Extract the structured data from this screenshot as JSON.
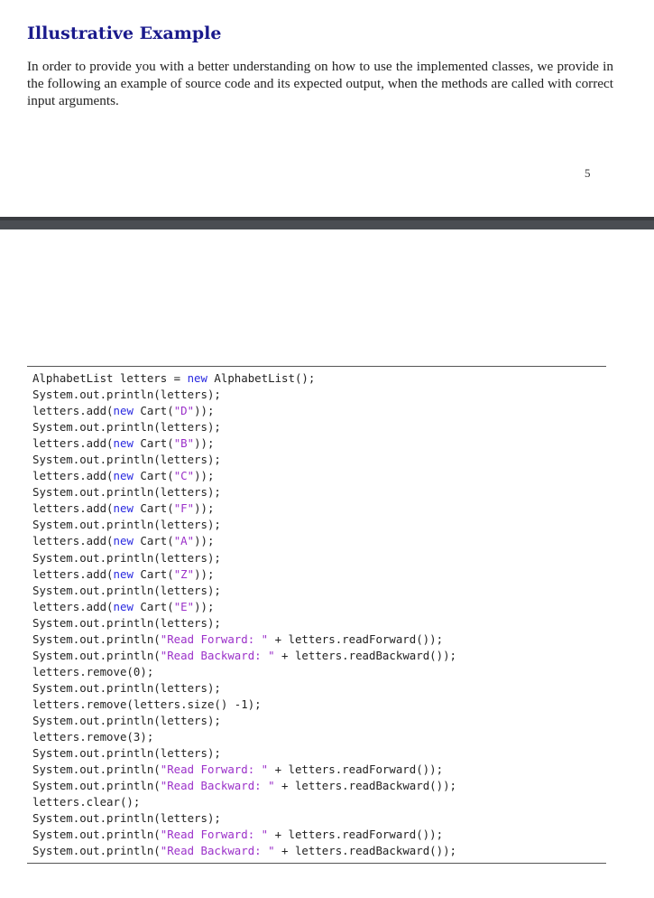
{
  "heading": "Illustrative Example",
  "intro": "In order to provide you with a better understanding on how to use the implemented classes, we provide in the following an example of source code and its expected output, when the methods are called with correct input arguments.",
  "page_number": "5",
  "code_lines": [
    [
      {
        "t": "AlphabetList letters = "
      },
      {
        "t": "new",
        "c": "kw"
      },
      {
        "t": " AlphabetList();"
      }
    ],
    [
      {
        "t": "System.out.println(letters);"
      }
    ],
    [
      {
        "t": "letters.add("
      },
      {
        "t": "new",
        "c": "kw"
      },
      {
        "t": " Cart("
      },
      {
        "t": "\"D\"",
        "c": "str"
      },
      {
        "t": "));"
      }
    ],
    [
      {
        "t": "System.out.println(letters);"
      }
    ],
    [
      {
        "t": "letters.add("
      },
      {
        "t": "new",
        "c": "kw"
      },
      {
        "t": " Cart("
      },
      {
        "t": "\"B\"",
        "c": "str"
      },
      {
        "t": "));"
      }
    ],
    [
      {
        "t": "System.out.println(letters);"
      }
    ],
    [
      {
        "t": "letters.add("
      },
      {
        "t": "new",
        "c": "kw"
      },
      {
        "t": " Cart("
      },
      {
        "t": "\"C\"",
        "c": "str"
      },
      {
        "t": "));"
      }
    ],
    [
      {
        "t": "System.out.println(letters);"
      }
    ],
    [
      {
        "t": "letters.add("
      },
      {
        "t": "new",
        "c": "kw"
      },
      {
        "t": " Cart("
      },
      {
        "t": "\"F\"",
        "c": "str"
      },
      {
        "t": "));"
      }
    ],
    [
      {
        "t": "System.out.println(letters);"
      }
    ],
    [
      {
        "t": "letters.add("
      },
      {
        "t": "new",
        "c": "kw"
      },
      {
        "t": " Cart("
      },
      {
        "t": "\"A\"",
        "c": "str"
      },
      {
        "t": "));"
      }
    ],
    [
      {
        "t": "System.out.println(letters);"
      }
    ],
    [
      {
        "t": "letters.add("
      },
      {
        "t": "new",
        "c": "kw"
      },
      {
        "t": " Cart("
      },
      {
        "t": "\"Z\"",
        "c": "str"
      },
      {
        "t": "));"
      }
    ],
    [
      {
        "t": "System.out.println(letters);"
      }
    ],
    [
      {
        "t": "letters.add("
      },
      {
        "t": "new",
        "c": "kw"
      },
      {
        "t": " Cart("
      },
      {
        "t": "\"E\"",
        "c": "str"
      },
      {
        "t": "));"
      }
    ],
    [
      {
        "t": "System.out.println(letters);"
      }
    ],
    [
      {
        "t": "System.out.println("
      },
      {
        "t": "\"Read Forward: \"",
        "c": "str"
      },
      {
        "t": " + letters.readForward());"
      }
    ],
    [
      {
        "t": "System.out.println("
      },
      {
        "t": "\"Read Backward: \"",
        "c": "str"
      },
      {
        "t": " + letters.readBackward());"
      }
    ],
    [
      {
        "t": "letters.remove(0);"
      }
    ],
    [
      {
        "t": "System.out.println(letters);"
      }
    ],
    [
      {
        "t": "letters.remove(letters.size() -1);"
      }
    ],
    [
      {
        "t": "System.out.println(letters);"
      }
    ],
    [
      {
        "t": "letters.remove(3);"
      }
    ],
    [
      {
        "t": "System.out.println(letters);"
      }
    ],
    [
      {
        "t": "System.out.println("
      },
      {
        "t": "\"Read Forward: \"",
        "c": "str"
      },
      {
        "t": " + letters.readForward());"
      }
    ],
    [
      {
        "t": "System.out.println("
      },
      {
        "t": "\"Read Backward: \"",
        "c": "str"
      },
      {
        "t": " + letters.readBackward());"
      }
    ],
    [
      {
        "t": "letters.clear();"
      }
    ],
    [
      {
        "t": "System.out.println(letters);"
      }
    ],
    [
      {
        "t": "System.out.println("
      },
      {
        "t": "\"Read Forward: \"",
        "c": "str"
      },
      {
        "t": " + letters.readForward());"
      }
    ],
    [
      {
        "t": "System.out.println("
      },
      {
        "t": "\"Read Backward: \"",
        "c": "str"
      },
      {
        "t": " + letters.readBackward());"
      }
    ]
  ],
  "colors": {
    "heading": "#1a1a8c",
    "keyword": "#2a2ae0",
    "string": "#9b30c9",
    "page_gap": "#4a4d52"
  }
}
